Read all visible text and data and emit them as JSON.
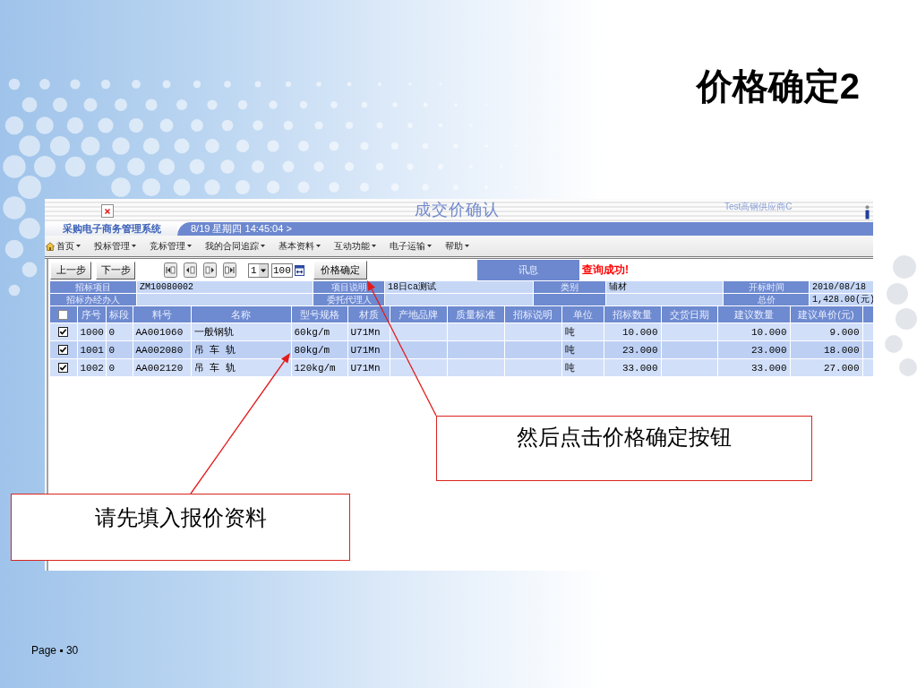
{
  "slide": {
    "title": "价格确定2",
    "page_label": "Page ▪ 30"
  },
  "window": {
    "header": {
      "title": "成交价确认",
      "user": "Test高钢供应商C"
    },
    "system_name": "采购电子商务管理系统",
    "datetime": "8/19 星期四 14:45:04 >",
    "menu": [
      {
        "label": "首页",
        "kind": "home"
      },
      {
        "label": "投标管理",
        "kind": "plain"
      },
      {
        "label": "竞标管理",
        "kind": "plain"
      },
      {
        "label": "我的合同追踪",
        "kind": "plain"
      },
      {
        "label": "基本资料",
        "kind": "plain"
      },
      {
        "label": "互动功能",
        "kind": "plain"
      },
      {
        "label": "电子运输",
        "kind": "plain"
      },
      {
        "label": "帮助",
        "kind": "plain"
      }
    ],
    "toolbar": {
      "prev_button": "上一步",
      "next_button": "下一步",
      "page_select": "1",
      "page_size": "100",
      "confirm_button": "价格确定",
      "message_label": "讯息",
      "message": "查询成功!"
    },
    "info_columns": [
      [
        {
          "label": "招标项目",
          "value": "ZM10080002"
        },
        {
          "label": "招标办经办人"
        }
      ],
      [
        {
          "label": "项目说明",
          "value": "18日ca测试"
        },
        {
          "label": "委托代理人"
        }
      ],
      [
        {
          "label": "类别",
          "value": "辅材"
        }
      ],
      [
        {
          "label": "开标时间",
          "value": "2010/08/18"
        },
        {
          "label": "总价",
          "value": "1,428.00(元)"
        }
      ]
    ],
    "table": {
      "select_all_checked": false,
      "columns": [
        {
          "label": "序号",
          "kind": "text"
        },
        {
          "label": "标段",
          "kind": "text"
        },
        {
          "label": "料号",
          "kind": "text"
        },
        {
          "label": "名称",
          "kind": "text"
        },
        {
          "label": "型号规格",
          "kind": "text"
        },
        {
          "label": "材质",
          "kind": "text"
        },
        {
          "label": "产地品牌",
          "kind": "text"
        },
        {
          "label": "质量标准",
          "kind": "text"
        },
        {
          "label": "招标说明",
          "kind": "text"
        },
        {
          "label": "单位",
          "kind": "text"
        },
        {
          "label": "招标数量",
          "kind": "number"
        },
        {
          "label": "交货日期",
          "kind": "text"
        },
        {
          "label": "建议数量",
          "kind": "number"
        },
        {
          "label": "建议单价(元)",
          "kind": "number"
        }
      ],
      "rows": [
        {
          "checked": true,
          "cells": [
            "1000",
            "0",
            "AA001060",
            "一般钢轨",
            "60kg/m",
            "U71Mn",
            null,
            null,
            null,
            "吨",
            "10.000",
            null,
            "10.000",
            "9.000"
          ]
        },
        {
          "checked": true,
          "cells": [
            "1001",
            "0",
            "AA002080",
            "吊 车 轨",
            "80kg/m",
            "U71Mn",
            null,
            null,
            null,
            "吨",
            "23.000",
            null,
            "23.000",
            "18.000"
          ]
        },
        {
          "checked": true,
          "cells": [
            "1002",
            "0",
            "AA002120",
            "吊 车 轨",
            "120kg/m",
            "U71Mn",
            null,
            null,
            null,
            "吨",
            "33.000",
            null,
            "33.000",
            "27.000"
          ]
        }
      ]
    }
  },
  "callouts": [
    {
      "text": "然后点击价格确定按钮"
    },
    {
      "text": "请先填入报价资料"
    }
  ]
}
